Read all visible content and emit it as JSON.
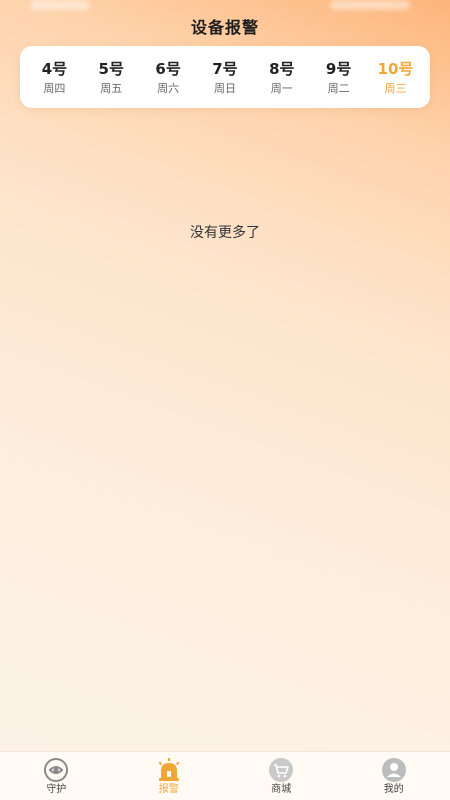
{
  "header": {
    "title": "设备报警"
  },
  "dates": [
    {
      "day": "4号",
      "weekday": "周四",
      "active": false
    },
    {
      "day": "5号",
      "weekday": "周五",
      "active": false
    },
    {
      "day": "6号",
      "weekday": "周六",
      "active": false
    },
    {
      "day": "7号",
      "weekday": "周日",
      "active": false
    },
    {
      "day": "8号",
      "weekday": "周一",
      "active": false
    },
    {
      "day": "9号",
      "weekday": "周二",
      "active": false
    },
    {
      "day": "10号",
      "weekday": "周三",
      "active": true
    }
  ],
  "content": {
    "empty_message": "没有更多了"
  },
  "tabbar": {
    "active_color": "#f0a638",
    "items": [
      {
        "label": "守护",
        "icon": "guard-icon",
        "active": false
      },
      {
        "label": "报警",
        "icon": "alarm-icon",
        "active": true
      },
      {
        "label": "商城",
        "icon": "cart-icon",
        "active": false
      },
      {
        "label": "我的",
        "icon": "user-icon",
        "active": false
      }
    ]
  }
}
